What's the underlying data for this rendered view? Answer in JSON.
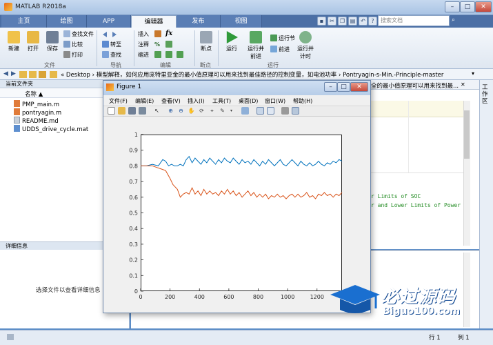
{
  "app": {
    "title": "MATLAB R2018a",
    "search_placeholder": "搜索文档",
    "min": "–",
    "max": "□",
    "close": "✕"
  },
  "tabs": [
    "主页",
    "绘图",
    "APP",
    "编辑器",
    "发布",
    "视图"
  ],
  "ribbon": {
    "file": {
      "new": "新建",
      "open": "打开",
      "save": "保存",
      "find_files": "查找文件",
      "compare": "比较",
      "print": "打印",
      "group": "文件"
    },
    "nav": {
      "goto": "转至",
      "find": "查找",
      "group": "导航"
    },
    "edit": {
      "insert": "插入",
      "fx": "fx",
      "comment": "注释",
      "percent": "%",
      "indent": "缩进",
      "group": "编辑"
    },
    "breakpoints": {
      "label": "断点",
      "group": "断点"
    },
    "run": {
      "run": "运行",
      "run_advance_1": "运行并",
      "run_advance_2": "前进",
      "run_section": "运行节",
      "advance": "前进",
      "run_time_1": "运行并",
      "run_time_2": "计时",
      "group": "运行"
    }
  },
  "path": "«  Desktop  ›  模型解释，如何应用庞特里亚金的最小值原理可以用来找到最佳路径的控制变量，如电池功率  ›  Pontryagin-s-Min.-Principle-master",
  "left_panel": {
    "header": "当前文件夹",
    "col_name": "名称 ▲",
    "files": [
      "PMP_main.m",
      "pontryagin.m",
      "README.md",
      "UDDS_drive_cycle.mat"
    ],
    "details_header": "详细信息",
    "details_hint": "选择文件以查看详细信息"
  },
  "editor": {
    "tab_text": "全的最小值原理可以用来找到最...",
    "code_line1": "r Limits of SOC",
    "code_line2": "r and Lower Limits of Power"
  },
  "right_strip": "工作区",
  "status": {
    "row": "行 1",
    "col": "列 1"
  },
  "figure": {
    "title": "Figure 1",
    "menus": [
      "文件(F)",
      "编辑(E)",
      "查看(V)",
      "插入(I)",
      "工具(T)",
      "桌面(D)",
      "窗口(W)",
      "帮助(H)"
    ]
  },
  "chart_data": {
    "type": "line",
    "xlim": [
      0,
      1370
    ],
    "ylim": [
      0,
      1
    ],
    "xticks": [
      0,
      200,
      400,
      600,
      800,
      1000,
      1200
    ],
    "yticks": [
      0,
      0.1,
      0.2,
      0.3,
      0.4,
      0.5,
      0.6,
      0.7,
      0.8,
      0.9,
      1
    ],
    "grid": false,
    "series": [
      {
        "color": "#0072bd",
        "x": [
          0,
          40,
          80,
          120,
          150,
          170,
          190,
          210,
          230,
          250,
          270,
          290,
          310,
          330,
          350,
          370,
          390,
          410,
          430,
          450,
          470,
          490,
          510,
          530,
          550,
          570,
          590,
          610,
          630,
          650,
          670,
          690,
          710,
          730,
          750,
          770,
          790,
          810,
          830,
          850,
          870,
          890,
          910,
          930,
          950,
          970,
          990,
          1010,
          1030,
          1050,
          1070,
          1090,
          1110,
          1130,
          1150,
          1170,
          1190,
          1210,
          1230,
          1250,
          1270,
          1290,
          1310,
          1330,
          1350,
          1370
        ],
        "y": [
          0.8,
          0.8,
          0.81,
          0.8,
          0.84,
          0.83,
          0.8,
          0.81,
          0.8,
          0.8,
          0.81,
          0.8,
          0.84,
          0.86,
          0.82,
          0.85,
          0.83,
          0.81,
          0.84,
          0.82,
          0.85,
          0.83,
          0.81,
          0.84,
          0.82,
          0.85,
          0.83,
          0.82,
          0.85,
          0.83,
          0.81,
          0.84,
          0.82,
          0.83,
          0.81,
          0.84,
          0.82,
          0.8,
          0.83,
          0.81,
          0.84,
          0.82,
          0.8,
          0.82,
          0.84,
          0.81,
          0.8,
          0.82,
          0.84,
          0.82,
          0.8,
          0.83,
          0.81,
          0.8,
          0.82,
          0.8,
          0.81,
          0.83,
          0.81,
          0.8,
          0.82,
          0.81,
          0.83,
          0.82,
          0.84,
          0.83
        ]
      },
      {
        "color": "#d95319",
        "x": [
          0,
          40,
          80,
          110,
          140,
          170,
          200,
          220,
          250,
          270,
          290,
          310,
          330,
          350,
          370,
          390,
          410,
          430,
          450,
          470,
          490,
          510,
          530,
          550,
          570,
          590,
          610,
          630,
          650,
          670,
          690,
          710,
          730,
          750,
          770,
          790,
          810,
          830,
          850,
          870,
          890,
          910,
          930,
          950,
          970,
          990,
          1010,
          1030,
          1050,
          1070,
          1090,
          1110,
          1130,
          1150,
          1170,
          1190,
          1210,
          1230,
          1250,
          1270,
          1290,
          1310,
          1330,
          1350,
          1370
        ],
        "y": [
          0.8,
          0.8,
          0.8,
          0.79,
          0.78,
          0.77,
          0.72,
          0.68,
          0.65,
          0.6,
          0.62,
          0.63,
          0.62,
          0.66,
          0.62,
          0.64,
          0.61,
          0.65,
          0.62,
          0.64,
          0.62,
          0.63,
          0.61,
          0.64,
          0.62,
          0.65,
          0.62,
          0.64,
          0.61,
          0.63,
          0.6,
          0.62,
          0.64,
          0.61,
          0.63,
          0.6,
          0.62,
          0.6,
          0.62,
          0.59,
          0.61,
          0.6,
          0.62,
          0.6,
          0.61,
          0.59,
          0.61,
          0.62,
          0.6,
          0.62,
          0.6,
          0.61,
          0.63,
          0.6,
          0.61,
          0.59,
          0.62,
          0.61,
          0.63,
          0.61,
          0.62,
          0.6,
          0.62,
          0.61,
          0.63
        ]
      }
    ]
  },
  "watermark": {
    "brand": "必过源码",
    "url": "Biguo100.com"
  }
}
